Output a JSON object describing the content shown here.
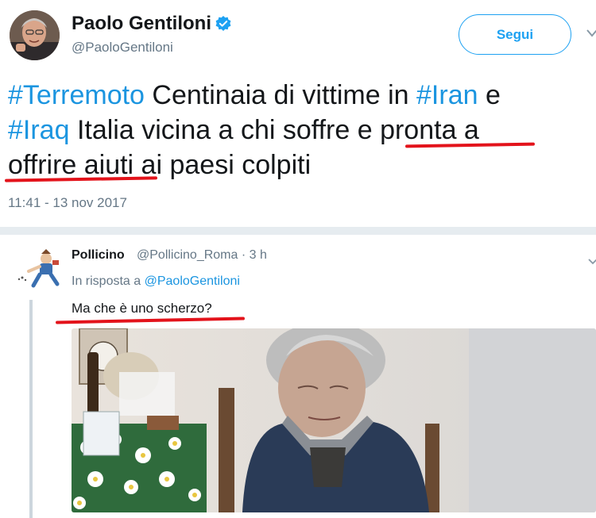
{
  "tweet": {
    "author_name": "Paolo Gentiloni",
    "author_handle": "@PaoloGentiloni",
    "follow_label": "Segui",
    "text": {
      "ht_terremoto": "#Terremoto",
      "part1": " Centinaia di vittime in ",
      "ht_iran": "#Iran",
      "part2": " e",
      "ht_iraq": "#Iraq",
      "part3": " Italia vicina a chi soffre e pronta a",
      "part4": "offrire aiuti ai paesi colpiti"
    },
    "timestamp": "11:41 - 13 nov 2017"
  },
  "reply": {
    "author_name": "Pollicino",
    "author_handle": "@Pollicino_Roma · 3 h",
    "in_reply_to_prefix": "In risposta a ",
    "in_reply_to_handle": "@PaoloGentiloni",
    "text": "Ma che è uno scherzo?"
  },
  "colors": {
    "link": "#1b95e0",
    "follow": "#1da1f2",
    "underline": "#e3131b",
    "verified": "#1da1f2"
  },
  "icons": [
    "verified-icon",
    "chevron-down-icon"
  ]
}
